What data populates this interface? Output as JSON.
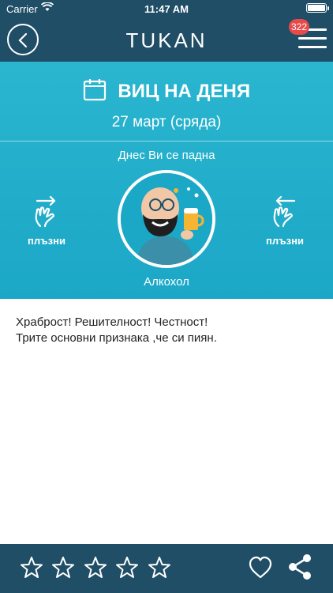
{
  "status_bar": {
    "carrier": "Carrier",
    "time": "11:47 AM"
  },
  "header": {
    "title": "TUKAN",
    "notification_count": "322"
  },
  "joke_of_day": {
    "title": "ВИЦ НА ДЕНЯ",
    "date": "27 март (сряда)",
    "subtitle": "Днес Ви се падна",
    "swipe_left_label": "плъзни",
    "swipe_right_label": "плъзни",
    "category": "Алкохол"
  },
  "joke": {
    "line1": "Храброст! Решителност! Честност!",
    "line2": "Трите основни признака ,че си пиян."
  },
  "rating": {
    "max_stars": 5,
    "selected": 0
  },
  "colors": {
    "header": "#1f4e66",
    "hero": "#1ba7c6",
    "badge": "#e84a4a"
  }
}
